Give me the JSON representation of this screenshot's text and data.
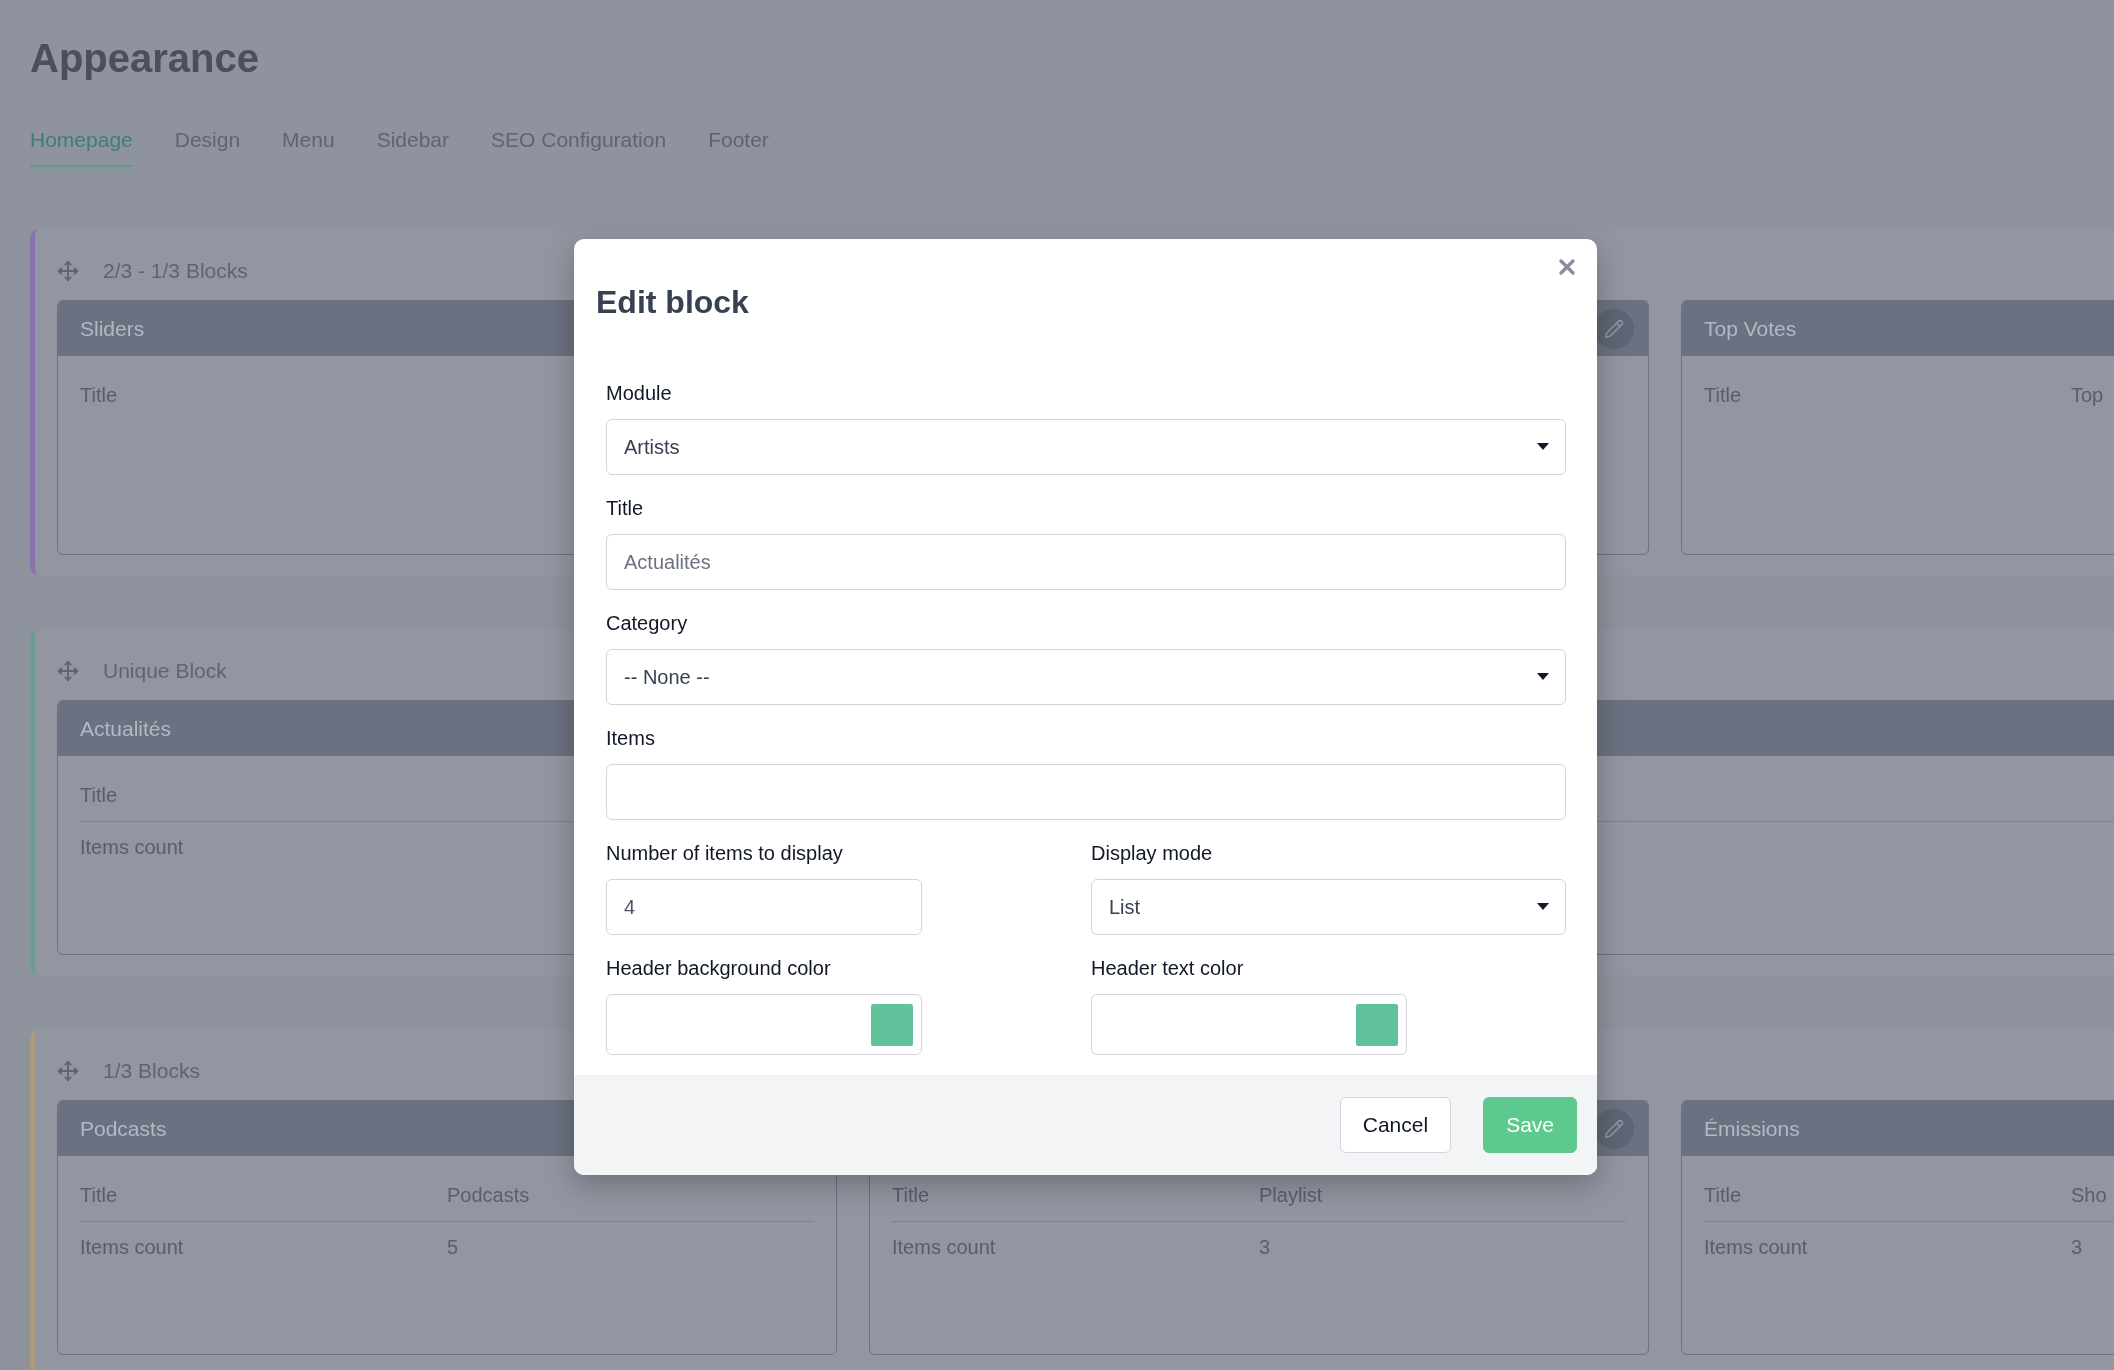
{
  "page": {
    "title": "Appearance"
  },
  "tabs": [
    {
      "label": "Homepage",
      "selected": true
    },
    {
      "label": "Design",
      "selected": false
    },
    {
      "label": "Menu",
      "selected": false
    },
    {
      "label": "Sidebar",
      "selected": false
    },
    {
      "label": "SEO Configuration",
      "selected": false
    },
    {
      "label": "Footer",
      "selected": false
    }
  ],
  "sections": [
    {
      "title": "2/3 - 1/3 Blocks",
      "color": "#8a74b0",
      "blocks": [
        {
          "kind": "wide",
          "title": "Sliders",
          "editable": true,
          "rows": [
            {
              "label": "Title"
            }
          ]
        },
        {
          "kind": "third",
          "title": "Top Votes",
          "editable": false,
          "rows": [
            {
              "label": "Title",
              "value": "Top"
            }
          ]
        }
      ]
    },
    {
      "title": "Unique Block",
      "color": "#6c9c95",
      "blocks": [
        {
          "kind": "full",
          "title": "Actualités",
          "editable": false,
          "rows": [
            {
              "label": "Title"
            },
            {
              "label": "Items count"
            }
          ]
        }
      ]
    },
    {
      "title": "1/3 Blocks",
      "color": "#a89b80",
      "blocks": [
        {
          "kind": "third",
          "title": "Podcasts",
          "editable": false,
          "rows": [
            {
              "label": "Title",
              "value": "Podcasts"
            },
            {
              "label": "Items count",
              "value": "5"
            }
          ]
        },
        {
          "kind": "third",
          "editable": true,
          "rows": [
            {
              "label": "Title",
              "value": "Playlist"
            },
            {
              "label": "Items count",
              "value": "3"
            }
          ]
        },
        {
          "kind": "third",
          "title": "Émissions",
          "editable": false,
          "rows": [
            {
              "label": "Title",
              "value": "Sho"
            },
            {
              "label": "Items count",
              "value": "3"
            }
          ]
        }
      ]
    }
  ],
  "modal": {
    "title": "Edit block",
    "rows": [
      [
        {
          "label": "Module",
          "kind": "select",
          "value": "Artists"
        }
      ],
      [
        {
          "label": "Title",
          "kind": "text",
          "placeholder": "Actualités"
        }
      ],
      [
        {
          "label": "Category",
          "kind": "select",
          "value": "-- None --"
        }
      ],
      [
        {
          "label": "Items",
          "kind": "text"
        }
      ],
      [
        {
          "label": "Number of items to display",
          "kind": "number",
          "value": "4"
        },
        {
          "label": "Display mode",
          "kind": "select",
          "value": "List"
        }
      ],
      [
        {
          "label": "Header background color",
          "kind": "color",
          "color": "#5fc29a"
        },
        {
          "label": "Header text color",
          "kind": "color",
          "color": "#5fc29a"
        }
      ]
    ],
    "buttons": [
      {
        "label": "Cancel",
        "kind": "secondary"
      },
      {
        "label": "Save",
        "kind": "primary"
      }
    ]
  }
}
